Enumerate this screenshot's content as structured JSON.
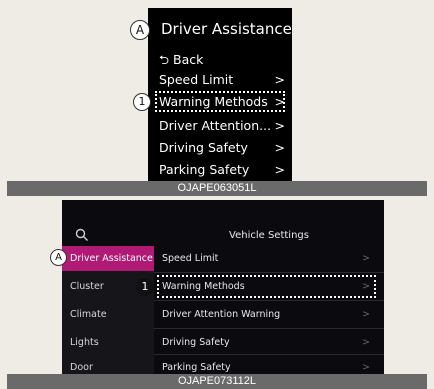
{
  "top_panel": {
    "callout_a": "A",
    "callout_1": "1",
    "title": "Driver Assistance",
    "back_label": "Back",
    "items": [
      {
        "label": "Speed Limit",
        "chevron": ">"
      },
      {
        "label": "Warning Methods",
        "chevron": ">"
      },
      {
        "label": "Driver Attention...",
        "chevron": ">"
      },
      {
        "label": "Driving Safety",
        "chevron": ">"
      },
      {
        "label": "Parking Safety",
        "chevron": ">"
      }
    ],
    "caption": "OJAPE063051L"
  },
  "bottom_panel": {
    "callout_a": "A",
    "callout_1": "1",
    "title": "Vehicle Settings",
    "left_items": [
      "Driver Assistance",
      "Cluster",
      "Climate",
      "Lights",
      "Door"
    ],
    "right_items": [
      {
        "label": "Speed Limit",
        "chevron": ">"
      },
      {
        "label": "Warning Methods",
        "chevron": ">"
      },
      {
        "label": "Driver Attention Warning",
        "chevron": ">"
      },
      {
        "label": "Driving Safety",
        "chevron": ">"
      },
      {
        "label": "Parking Safety",
        "chevron": ">"
      }
    ],
    "caption": "OJAPE073112L"
  },
  "colors": {
    "selected_menu": "#b01a74",
    "screen_bg": "#000000",
    "page_bg": "#efece6",
    "caption_bg": "#6a6a6a"
  }
}
